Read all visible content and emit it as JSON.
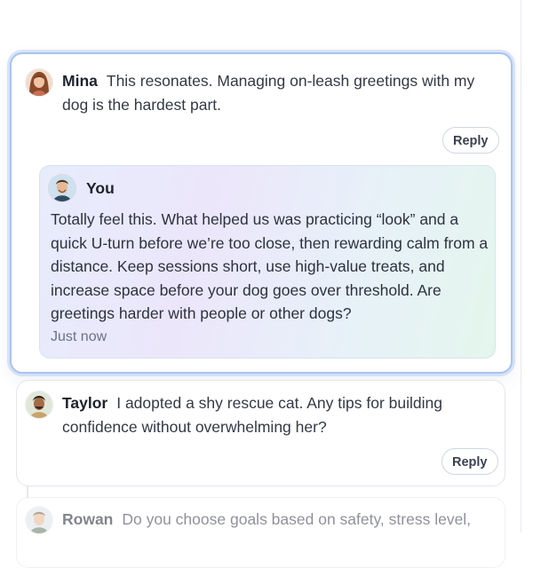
{
  "comments": [
    {
      "author": "Mina",
      "text": "This resonates. Managing on-leash greetings with my dog is the hardest part.",
      "reply_label": "Reply",
      "reply": {
        "author": "You",
        "text": "Totally feel this. What helped us was practicing “look” and a quick U-turn before we’re too close, then rewarding calm from a distance. Keep sessions short, use high-value treats, and increase space before your dog goes over threshold. Are greetings harder with people or other dogs?",
        "time": "Just now"
      }
    },
    {
      "author": "Taylor",
      "text": "I adopted a shy rescue cat. Any tips for building confidence without overwhelming her?",
      "reply_label": "Reply"
    },
    {
      "author": "Rowan",
      "text": "Do you choose goals based on safety, stress level,"
    }
  ],
  "colors": {
    "active_border": "#a9c3ef",
    "reply_gradient_start": "#e7ecfb",
    "reply_gradient_end": "#e4f6ec"
  },
  "icons": [
    "avatar-mina",
    "avatar-you",
    "avatar-taylor",
    "avatar-rowan"
  ]
}
